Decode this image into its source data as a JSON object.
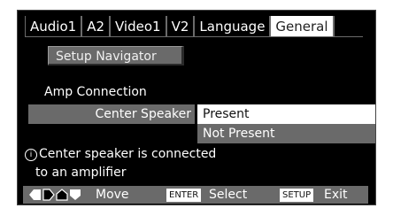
{
  "tabs": [
    {
      "label": "Audio1",
      "active": false
    },
    {
      "label": "A2",
      "active": false
    },
    {
      "label": "Video1",
      "active": false
    },
    {
      "label": "V2",
      "active": false
    },
    {
      "label": "Language",
      "active": false
    },
    {
      "label": "General",
      "active": true
    }
  ],
  "navigator": {
    "label": "Setup Navigator"
  },
  "section": {
    "title": "Amp Connection"
  },
  "setting": {
    "label": "Center Speaker",
    "options": [
      "Present",
      "Not Present"
    ],
    "selected": "Present"
  },
  "info": {
    "icon": "info-icon",
    "line1": "Center speaker is connected",
    "line2": "to an amplifier"
  },
  "bottom_bar": {
    "arrows_icon": "arrow-keys-icon",
    "move_label": "Move",
    "enter_key": "ENTER",
    "select_label": "Select",
    "setup_key": "SETUP",
    "exit_label": "Exit"
  },
  "colors": {
    "background": "#000000",
    "panel_gray": "#6a6a6a",
    "highlight": "#ffffff",
    "text": "#ffffff"
  }
}
